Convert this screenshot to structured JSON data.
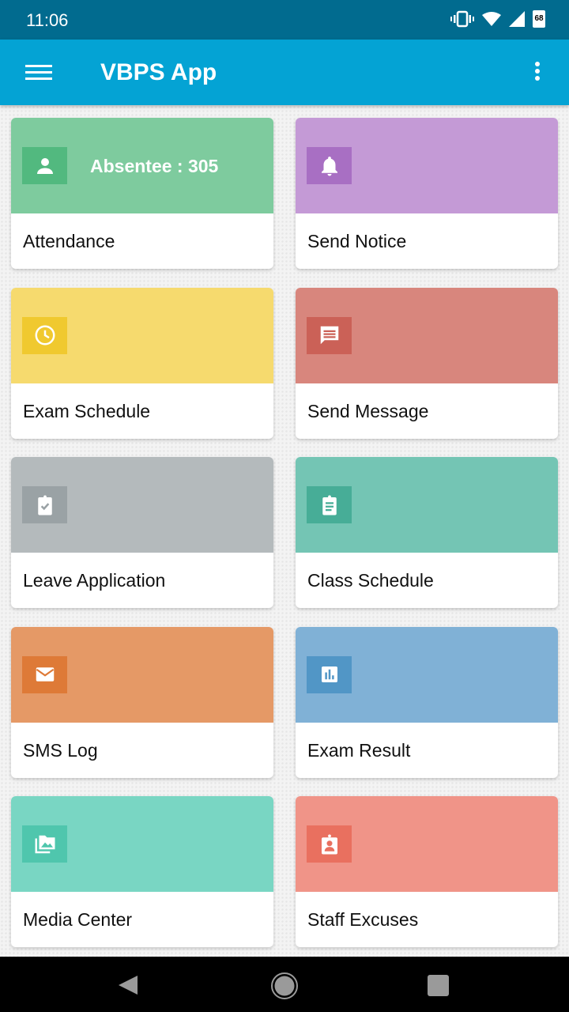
{
  "status_bar": {
    "time": "11:06",
    "battery": "68",
    "icons": [
      "vibrate-icon",
      "wifi-icon",
      "signal-icon",
      "battery-icon"
    ]
  },
  "app_bar": {
    "title": "VBPS App",
    "menu_icon": "hamburger-menu-icon",
    "more_icon": "more-vertical-icon"
  },
  "tiles": [
    {
      "label": "Attendance",
      "badge": "Absentee : 305",
      "icon": "person-icon",
      "color": "#7ecb9e",
      "icon_bg": "#52b97f"
    },
    {
      "label": "Send Notice",
      "badge": "",
      "icon": "bell-icon",
      "color": "#c49ad6",
      "icon_bg": "#a86fc3"
    },
    {
      "label": "Exam Schedule",
      "badge": "",
      "icon": "clock-icon",
      "color": "#f6da6e",
      "icon_bg": "#f0c92f"
    },
    {
      "label": "Send Message",
      "badge": "",
      "icon": "message-icon",
      "color": "#d8867d",
      "icon_bg": "#cb6157"
    },
    {
      "label": "Leave Application",
      "badge": "",
      "icon": "clipboard-check-icon",
      "color": "#b4babc",
      "icon_bg": "#9aa2a5"
    },
    {
      "label": "Class Schedule",
      "badge": "",
      "icon": "clipboard-list-icon",
      "color": "#74c5b4",
      "icon_bg": "#47ad97"
    },
    {
      "label": "SMS Log",
      "badge": "",
      "icon": "mail-icon",
      "color": "#e59966",
      "icon_bg": "#de7a37"
    },
    {
      "label": "Exam Result",
      "badge": "",
      "icon": "bar-chart-icon",
      "color": "#80b1d6",
      "icon_bg": "#5196c6"
    },
    {
      "label": "Media Center",
      "badge": "",
      "icon": "photo-library-icon",
      "color": "#79d6c3",
      "icon_bg": "#4fc6ad"
    },
    {
      "label": "Staff Excuses",
      "badge": "",
      "icon": "badge-icon",
      "color": "#f09488",
      "icon_bg": "#e9705f"
    }
  ],
  "nav_bar": {
    "back": "back-icon",
    "home": "home-icon",
    "recents": "recents-icon"
  }
}
